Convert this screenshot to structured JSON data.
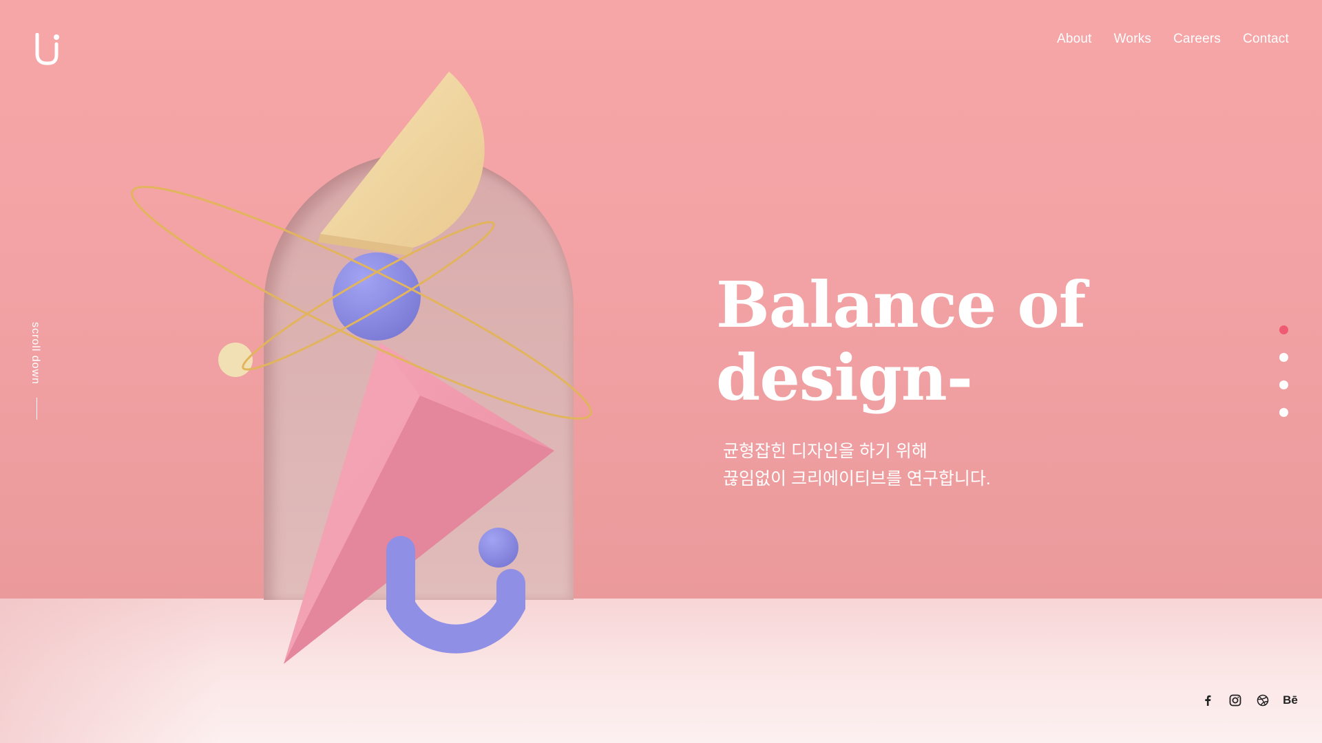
{
  "brand": {
    "logo_icon": "ui-logo-icon"
  },
  "nav": {
    "items": [
      {
        "label": "About"
      },
      {
        "label": "Works"
      },
      {
        "label": "Careers"
      },
      {
        "label": "Contact"
      }
    ]
  },
  "hero": {
    "headline_line1": "Balance of",
    "headline_line2": "design-",
    "subtitle_line1": "균형잡힌 디자인을 하기 위해",
    "subtitle_line2": "끊임없이 크리에이티브를 연구합니다."
  },
  "scroll": {
    "label": "scroll down"
  },
  "pagination": {
    "total": 4,
    "active_index": 0
  },
  "social": {
    "icons": [
      "facebook-icon",
      "instagram-icon",
      "dribbble-icon",
      "behance-icon"
    ],
    "behance_glyph": "Bē"
  },
  "colors": {
    "background": "#f4a6a8",
    "accent_dot": "#ef5b73",
    "purple": "#8f8fe6",
    "pink_cone": "#ef8fa3",
    "cream": "#f3d7a1"
  }
}
